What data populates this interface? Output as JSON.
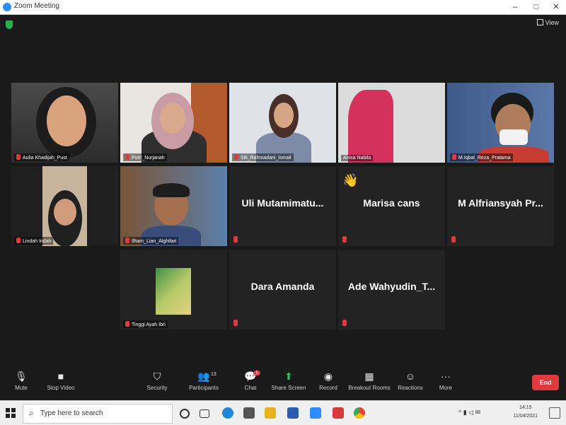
{
  "window": {
    "title": "Zoom Meeting",
    "controls": [
      "–",
      "□",
      "✕"
    ]
  },
  "stage": {
    "view_label": "View"
  },
  "participants": [
    {
      "name": "Aulia Khadijah_Pust",
      "type": "video"
    },
    {
      "name": "Putri_Nurjanah",
      "type": "video"
    },
    {
      "name": "Siti_Rahmadani_Ismail",
      "type": "video"
    },
    {
      "name": "Anisa Nabila",
      "type": "video"
    },
    {
      "name": "M.Iqbal_Reza_Pratama",
      "type": "video"
    },
    {
      "name": "Lindah Indah",
      "type": "video"
    },
    {
      "name": "Ilham_Lian_Alghifari",
      "type": "video"
    },
    {
      "name": "Uli Mutamimatu...",
      "type": "name"
    },
    {
      "name": "Marisa cans",
      "type": "name",
      "reaction": "👋"
    },
    {
      "name": "M Alfriansyah Pr...",
      "type": "name"
    },
    {
      "name": "Tinggi Ayah Ibri",
      "type": "thumb"
    },
    {
      "name": "Dara Amanda",
      "type": "name"
    },
    {
      "name": "Ade Wahyudin_T...",
      "type": "name"
    }
  ],
  "toolbar": {
    "mute": "Mute",
    "stop_video": "Stop Video",
    "security": "Security",
    "participants": "Participants",
    "participants_count": "13",
    "chat": "Chat",
    "chat_badge": "1",
    "share_screen": "Share Screen",
    "record": "Record",
    "breakout_rooms": "Breakout Rooms",
    "reactions": "Reactions",
    "more": "More",
    "end": "End"
  },
  "taskbar": {
    "search_placeholder": "Type here to search",
    "time": "14:15",
    "date": "11/04/2021"
  },
  "colors": {
    "end_red": "#e0393e",
    "share_green": "#24c35c",
    "active_speaker": "#d7e040"
  }
}
